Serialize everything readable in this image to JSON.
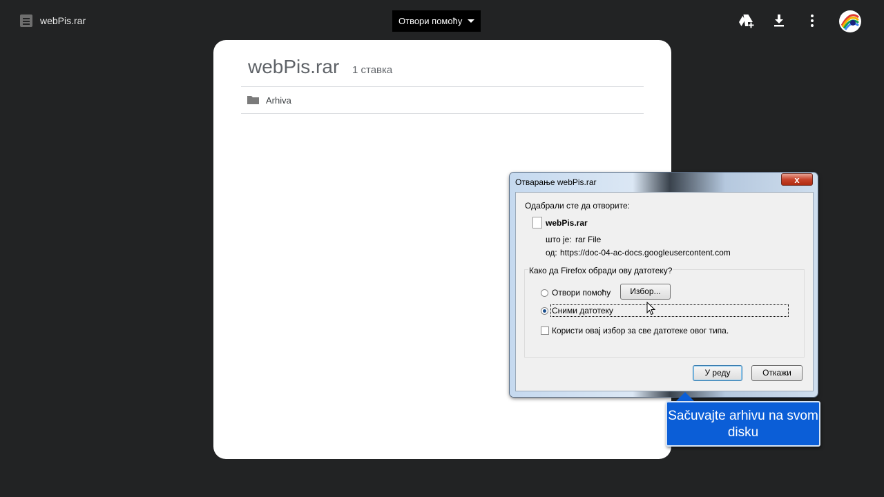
{
  "topbar": {
    "file_icon": "archive-file-icon",
    "title": "webPis.rar",
    "open_with_label": "Отвори помоћу",
    "icons": [
      "add-to-drive-icon",
      "download-icon",
      "more-vert-icon",
      "avatar"
    ]
  },
  "preview": {
    "archive_name": "webPis.rar",
    "item_count": "1 ставка",
    "items": [
      {
        "icon": "folder-icon",
        "name": "Arhiva"
      }
    ]
  },
  "dialog": {
    "title": "Отварање webPis.rar",
    "close_label": "x",
    "intro": "Одабрали сте да отворите:",
    "file_name": "webPis.rar",
    "type_label": "што је:",
    "type_value": "rar File",
    "from_label": "од:",
    "from_value": "https://doc-04-ac-docs.googleusercontent.com",
    "question": "Како да Firefox обради ову датотеку?",
    "option_open": "Отвори помоћу",
    "choose_button": "Избор...",
    "option_save": "Сними датотеку",
    "remember_label": "Користи овај избор за све датотеке овог типа.",
    "ok_button": "У реду",
    "cancel_button": "Откажи",
    "selected_option": "save",
    "remember_checked": false
  },
  "callout": {
    "text": "Sačuvajte arhivu na svom disku"
  },
  "colors": {
    "background": "#222324",
    "callout": "#0b5ed7",
    "card": "#ffffff"
  }
}
